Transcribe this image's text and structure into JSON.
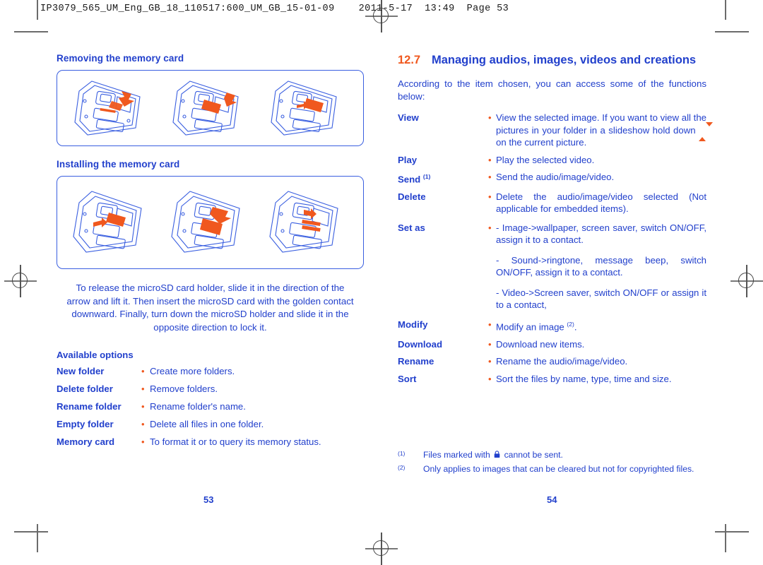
{
  "print_header": "IP3079_565_UM_Eng_GB_18_110517:600_UM_GB_15-01-09    2011-5-17  13:49  Page 53",
  "colors": {
    "blue": "#2240cc",
    "orange": "#f0581e",
    "rule": "#6b6b6b"
  },
  "left_page": {
    "page_number": "53",
    "section_removing": {
      "heading": "Removing the memory card"
    },
    "section_installing": {
      "heading": "Installing the memory card"
    },
    "instruction_paragraph": "To release the microSD card holder, slide it in the direction of the arrow and lift it. Then insert the microSD card with the golden contact downward. Finally, turn down the microSD holder and slide it in the opposite direction to lock it.",
    "available_options": {
      "heading": "Available options",
      "rows": [
        {
          "term": "New folder",
          "bullet": "•",
          "desc": "Create more folders."
        },
        {
          "term": "Delete folder",
          "bullet": "•",
          "desc": "Remove folders."
        },
        {
          "term": "Rename folder",
          "bullet": "•",
          "desc": "Rename folder's name."
        },
        {
          "term": "Empty folder",
          "bullet": "•",
          "desc": "Delete all files in one folder."
        },
        {
          "term": "Memory card",
          "bullet": "•",
          "desc": "To format it or to query its memory status."
        }
      ]
    }
  },
  "right_page": {
    "page_number": "54",
    "section_number": "12.7",
    "section_title": "Managing audios, images, videos and creations",
    "intro": "According to the item chosen, you can access some of the functions below:",
    "functions": [
      {
        "term": "View",
        "sup": "",
        "bullet": "•",
        "desc_before": "View the selected image. If you want to view all the pictures in your folder in a slideshow hold down ",
        "nav_icon": "up-down-navigation-key-icon",
        "desc_after": " on the current picture.",
        "sub_items": []
      },
      {
        "term": "Play",
        "sup": "",
        "bullet": "•",
        "desc": "Play the selected video.",
        "sub_items": []
      },
      {
        "term": "Send",
        "sup": "(1)",
        "bullet": "•",
        "desc": "Send the audio/image/video.",
        "sub_items": []
      },
      {
        "term": "Delete",
        "sup": "",
        "bullet": "•",
        "desc": "Delete the audio/image/video selected (Not applicable for embedded items).",
        "sub_items": []
      },
      {
        "term": "Set as",
        "sup": "",
        "bullet": "•",
        "desc": "",
        "sub_items": [
          "- Image->wallpaper, screen saver, switch ON/OFF, assign it to a contact.",
          "- Sound->ringtone, message beep, switch ON/OFF, assign it to a contact.",
          "- Video->Screen saver, switch ON/OFF or assign it to a contact,"
        ]
      },
      {
        "term": "Modify",
        "sup": "",
        "bullet": "•",
        "desc": "Modify an image ",
        "desc_sup": "(2)",
        "desc_tail": ".",
        "sub_items": []
      },
      {
        "term": "Download",
        "sup": "",
        "bullet": "•",
        "desc": "Download new items.",
        "sub_items": []
      },
      {
        "term": "Rename",
        "sup": "",
        "bullet": "•",
        "desc": "Rename the audio/image/video.",
        "sub_items": []
      },
      {
        "term": "Sort",
        "sup": "",
        "bullet": "•",
        "desc": "Sort the files by name, type, time and size.",
        "sub_items": []
      }
    ],
    "footnotes": [
      {
        "mark": "(1)",
        "text_before": "Files marked with ",
        "icon": "lock-icon",
        "text_after": " cannot be sent."
      },
      {
        "mark": "(2)",
        "text_before": "Only applies to images that can be cleared but not for copyrighted files.",
        "icon": "",
        "text_after": ""
      }
    ]
  }
}
